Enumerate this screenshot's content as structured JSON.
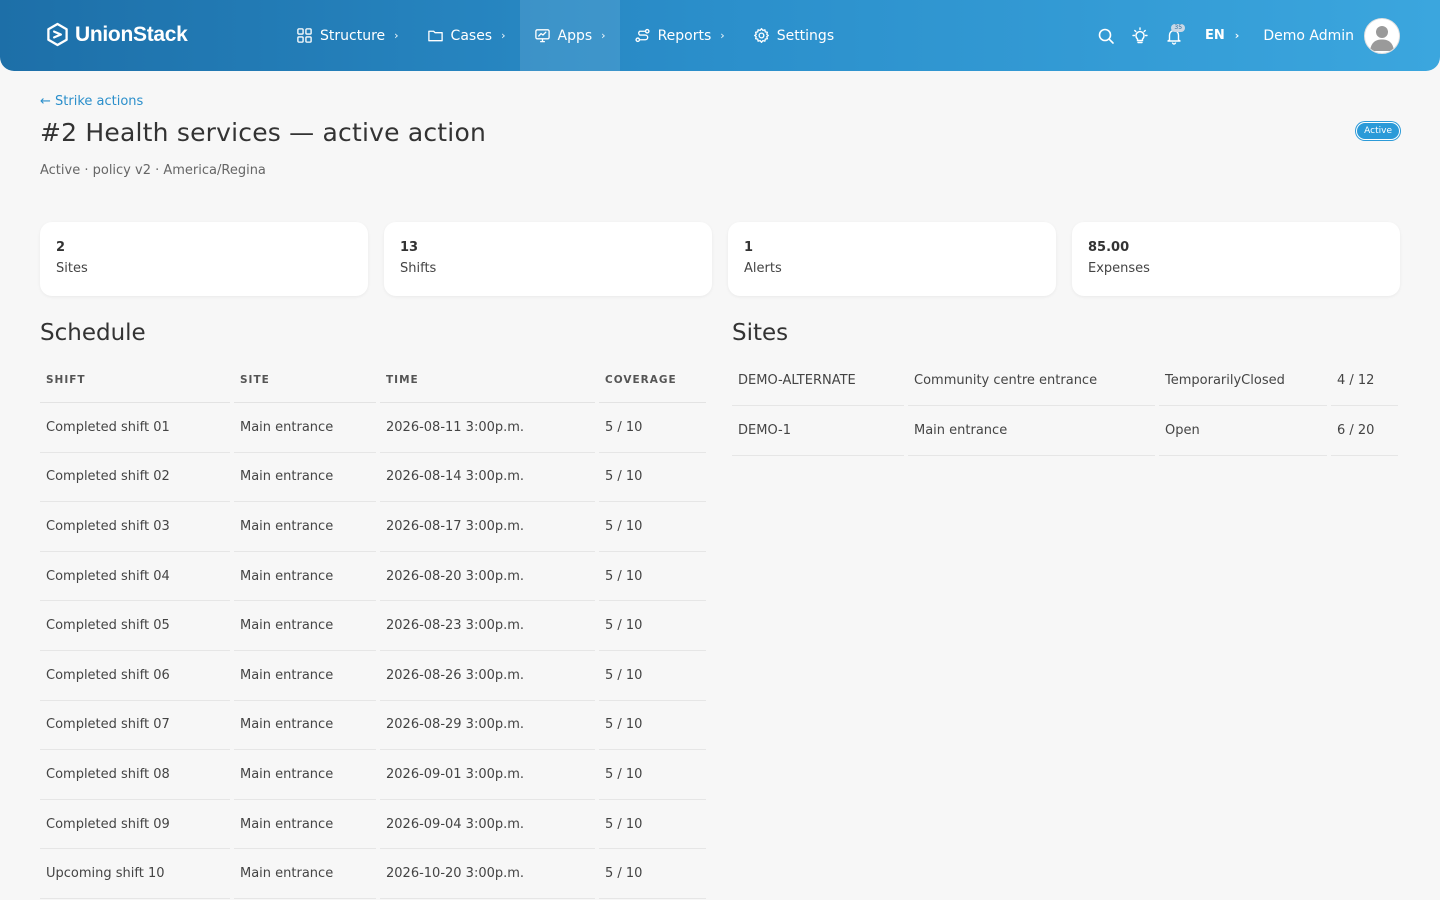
{
  "app": {
    "brand": "UnionStack"
  },
  "nav": {
    "items": [
      {
        "label": "Structure",
        "icon": "grid-icon"
      },
      {
        "label": "Cases",
        "icon": "folder-icon"
      },
      {
        "label": "Apps",
        "icon": "monitor-icon"
      },
      {
        "label": "Reports",
        "icon": "route-icon"
      },
      {
        "label": "Settings",
        "icon": "gear-icon"
      }
    ],
    "active": "Apps",
    "notification_count": "35",
    "language": "EN",
    "user_name": "Demo Admin"
  },
  "page": {
    "back_link": "← Strike actions",
    "title": "#2 Health services — active action",
    "subtitle": "Active · policy v2 · America/Regina",
    "status": "Active"
  },
  "stats": [
    {
      "value": "2",
      "label": "Sites"
    },
    {
      "value": "13",
      "label": "Shifts"
    },
    {
      "value": "1",
      "label": "Alerts"
    },
    {
      "value": "85.00",
      "label": "Expenses"
    }
  ],
  "schedule": {
    "title": "Schedule",
    "columns": [
      "SHIFT",
      "SITE",
      "TIME",
      "COVERAGE"
    ],
    "rows": [
      [
        "Completed shift 01",
        "Main entrance",
        "2026-08-11 3:00p.m.",
        "5 / 10"
      ],
      [
        "Completed shift 02",
        "Main entrance",
        "2026-08-14 3:00p.m.",
        "5 / 10"
      ],
      [
        "Completed shift 03",
        "Main entrance",
        "2026-08-17 3:00p.m.",
        "5 / 10"
      ],
      [
        "Completed shift 04",
        "Main entrance",
        "2026-08-20 3:00p.m.",
        "5 / 10"
      ],
      [
        "Completed shift 05",
        "Main entrance",
        "2026-08-23 3:00p.m.",
        "5 / 10"
      ],
      [
        "Completed shift 06",
        "Main entrance",
        "2026-08-26 3:00p.m.",
        "5 / 10"
      ],
      [
        "Completed shift 07",
        "Main entrance",
        "2026-08-29 3:00p.m.",
        "5 / 10"
      ],
      [
        "Completed shift 08",
        "Main entrance",
        "2026-09-01 3:00p.m.",
        "5 / 10"
      ],
      [
        "Completed shift 09",
        "Main entrance",
        "2026-09-04 3:00p.m.",
        "5 / 10"
      ],
      [
        "Upcoming shift 10",
        "Main entrance",
        "2026-10-20 3:00p.m.",
        "5 / 10"
      ]
    ]
  },
  "sites": {
    "title": "Sites",
    "rows": [
      [
        "DEMO-ALTERNATE",
        "Community centre entrance",
        "TemporarilyClosed",
        "4 / 12"
      ],
      [
        "DEMO-1",
        "Main entrance",
        "Open",
        "6 / 20"
      ]
    ]
  },
  "colors": {
    "accent": "#2b8fcb",
    "header_start": "#1d6fa8",
    "header_end": "#3ba6de"
  }
}
